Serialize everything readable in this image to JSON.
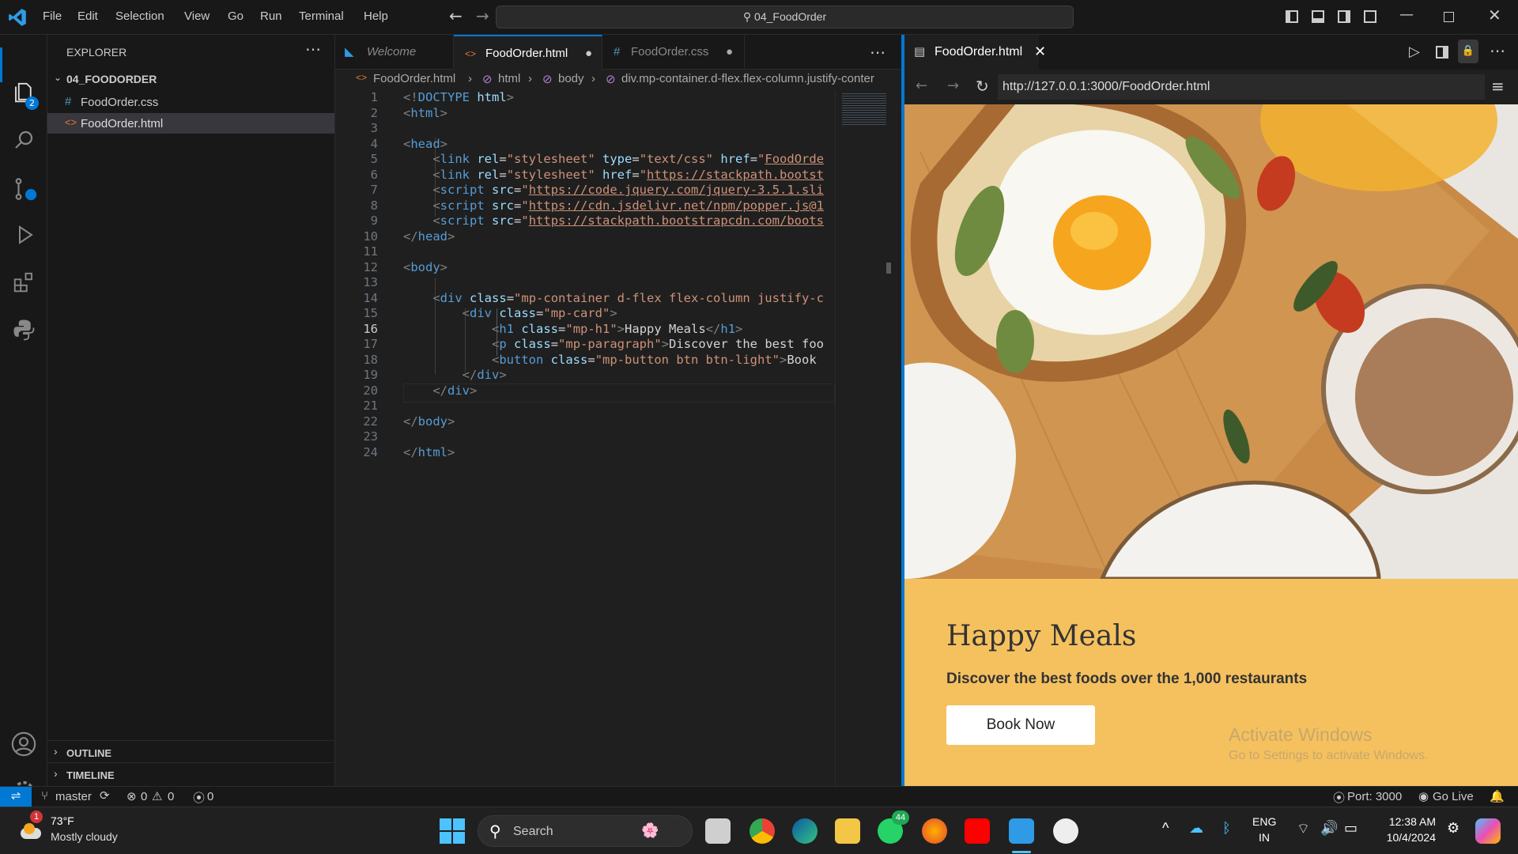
{
  "menu": {
    "file": "File",
    "edit": "Edit",
    "selection": "Selection",
    "view": "View",
    "go": "Go",
    "run": "Run",
    "terminal": "Terminal",
    "help": "Help"
  },
  "command_center": "04_FoodOrder",
  "activity_badge": "2",
  "explorer": {
    "title": "EXPLORER",
    "folder": "04_FOODORDER",
    "files": [
      "FoodOrder.css",
      "FoodOrder.html"
    ],
    "outline": "OUTLINE",
    "timeline": "TIMELINE"
  },
  "tabs": [
    "Welcome",
    "FoodOrder.html",
    "FoodOrder.css"
  ],
  "breadcrumb": {
    "file": "FoodOrder.html",
    "html": "html",
    "body": "body",
    "div": "div.mp-container.d-flex.flex-column.justify-conter"
  },
  "code_lines": [
    {
      "n": "1",
      "parts": [
        [
          "tg",
          "<!"
        ],
        [
          "kw",
          "DOCTYPE"
        ],
        [
          "tx",
          " "
        ],
        [
          "at",
          "html"
        ],
        [
          "tg",
          ">"
        ]
      ]
    },
    {
      "n": "2",
      "parts": [
        [
          "tg",
          "<"
        ],
        [
          "kw",
          "html"
        ],
        [
          "tg",
          ">"
        ]
      ]
    },
    {
      "n": "3",
      "parts": []
    },
    {
      "n": "4",
      "parts": [
        [
          "tg",
          "<"
        ],
        [
          "kw",
          "head"
        ],
        [
          "tg",
          ">"
        ]
      ]
    },
    {
      "n": "5",
      "parts": [
        [
          "tx",
          "    "
        ],
        [
          "tg",
          "<"
        ],
        [
          "kw",
          "link"
        ],
        [
          "tx",
          " "
        ],
        [
          "at",
          "rel"
        ],
        [
          "tx",
          "="
        ],
        [
          "st",
          "\"stylesheet\""
        ],
        [
          "tx",
          " "
        ],
        [
          "at",
          "type"
        ],
        [
          "tx",
          "="
        ],
        [
          "st",
          "\"text/css\""
        ],
        [
          "tx",
          " "
        ],
        [
          "at",
          "href"
        ],
        [
          "tx",
          "="
        ],
        [
          "st",
          "\""
        ],
        [
          "stu",
          "FoodOrde"
        ]
      ]
    },
    {
      "n": "6",
      "parts": [
        [
          "tx",
          "    "
        ],
        [
          "tg",
          "<"
        ],
        [
          "kw",
          "link"
        ],
        [
          "tx",
          " "
        ],
        [
          "at",
          "rel"
        ],
        [
          "tx",
          "="
        ],
        [
          "st",
          "\"stylesheet\""
        ],
        [
          "tx",
          " "
        ],
        [
          "at",
          "href"
        ],
        [
          "tx",
          "="
        ],
        [
          "st",
          "\""
        ],
        [
          "stu",
          "https://stackpath.bootst"
        ]
      ]
    },
    {
      "n": "7",
      "parts": [
        [
          "tx",
          "    "
        ],
        [
          "tg",
          "<"
        ],
        [
          "kw",
          "script"
        ],
        [
          "tx",
          " "
        ],
        [
          "at",
          "src"
        ],
        [
          "tx",
          "="
        ],
        [
          "st",
          "\""
        ],
        [
          "stu",
          "https://code.jquery.com/jquery-3.5.1.sli"
        ]
      ]
    },
    {
      "n": "8",
      "parts": [
        [
          "tx",
          "    "
        ],
        [
          "tg",
          "<"
        ],
        [
          "kw",
          "script"
        ],
        [
          "tx",
          " "
        ],
        [
          "at",
          "src"
        ],
        [
          "tx",
          "="
        ],
        [
          "st",
          "\""
        ],
        [
          "stu",
          "https://cdn.jsdelivr.net/npm/popper.js@1"
        ]
      ]
    },
    {
      "n": "9",
      "parts": [
        [
          "tx",
          "    "
        ],
        [
          "tg",
          "<"
        ],
        [
          "kw",
          "script"
        ],
        [
          "tx",
          " "
        ],
        [
          "at",
          "src"
        ],
        [
          "tx",
          "="
        ],
        [
          "st",
          "\""
        ],
        [
          "stu",
          "https://stackpath.bootstrapcdn.com/boots"
        ]
      ]
    },
    {
      "n": "10",
      "parts": [
        [
          "tg",
          "</"
        ],
        [
          "kw",
          "head"
        ],
        [
          "tg",
          ">"
        ]
      ]
    },
    {
      "n": "11",
      "parts": []
    },
    {
      "n": "12",
      "parts": [
        [
          "tg",
          "<"
        ],
        [
          "kw",
          "body"
        ],
        [
          "tg",
          ">"
        ]
      ]
    },
    {
      "n": "13",
      "parts": []
    },
    {
      "n": "14",
      "parts": [
        [
          "tx",
          "    "
        ],
        [
          "tg",
          "<"
        ],
        [
          "kw",
          "div"
        ],
        [
          "tx",
          " "
        ],
        [
          "at",
          "class"
        ],
        [
          "tx",
          "="
        ],
        [
          "st",
          "\"mp-container d-flex flex-column justify-c"
        ]
      ]
    },
    {
      "n": "15",
      "parts": [
        [
          "tx",
          "        "
        ],
        [
          "tg",
          "<"
        ],
        [
          "kw",
          "div"
        ],
        [
          "tx",
          " "
        ],
        [
          "at",
          "class"
        ],
        [
          "tx",
          "="
        ],
        [
          "st",
          "\"mp-card\""
        ],
        [
          "tg",
          ">"
        ]
      ]
    },
    {
      "n": "16",
      "parts": [
        [
          "tx",
          "            "
        ],
        [
          "tg",
          "<"
        ],
        [
          "kw",
          "h1"
        ],
        [
          "tx",
          " "
        ],
        [
          "at",
          "class"
        ],
        [
          "tx",
          "="
        ],
        [
          "st",
          "\"mp-h1\""
        ],
        [
          "tg",
          ">"
        ],
        [
          "tx",
          "Happy Meals"
        ],
        [
          "tg",
          "</"
        ],
        [
          "kw",
          "h1"
        ],
        [
          "tg",
          ">"
        ]
      ]
    },
    {
      "n": "17",
      "parts": [
        [
          "tx",
          "            "
        ],
        [
          "tg",
          "<"
        ],
        [
          "kw",
          "p"
        ],
        [
          "tx",
          " "
        ],
        [
          "at",
          "class"
        ],
        [
          "tx",
          "="
        ],
        [
          "st",
          "\"mp-paragraph\""
        ],
        [
          "tg",
          ">"
        ],
        [
          "tx",
          "Discover the best foo"
        ]
      ]
    },
    {
      "n": "18",
      "parts": [
        [
          "tx",
          "            "
        ],
        [
          "tg",
          "<"
        ],
        [
          "kw",
          "button"
        ],
        [
          "tx",
          " "
        ],
        [
          "at",
          "class"
        ],
        [
          "tx",
          "="
        ],
        [
          "st",
          "\"mp-button btn btn-light\""
        ],
        [
          "tg",
          ">"
        ],
        [
          "tx",
          "Book"
        ]
      ]
    },
    {
      "n": "19",
      "parts": [
        [
          "tx",
          "        "
        ],
        [
          "tg",
          "</"
        ],
        [
          "kw",
          "div"
        ],
        [
          "tg",
          ">"
        ]
      ]
    },
    {
      "n": "20",
      "parts": [
        [
          "tx",
          "    "
        ],
        [
          "tg",
          "</"
        ],
        [
          "kw",
          "div"
        ],
        [
          "tg",
          ">"
        ]
      ]
    },
    {
      "n": "21",
      "parts": []
    },
    {
      "n": "22",
      "parts": [
        [
          "tg",
          "</"
        ],
        [
          "kw",
          "body"
        ],
        [
          "tg",
          ">"
        ]
      ]
    },
    {
      "n": "23",
      "parts": []
    },
    {
      "n": "24",
      "parts": [
        [
          "tg",
          "</"
        ],
        [
          "kw",
          "html"
        ],
        [
          "tg",
          ">"
        ]
      ]
    }
  ],
  "browser": {
    "tab_title": "FoodOrder.html",
    "url": "http://127.0.0.1:3000/FoodOrder.html"
  },
  "page": {
    "heading": "Happy Meals",
    "paragraph": "Discover the best foods over the 1,000 restaurants",
    "button": "Book Now"
  },
  "watermark": {
    "title": "Activate Windows",
    "subtitle": "Go to Settings to activate Windows."
  },
  "status": {
    "branch": "master",
    "errors": "0",
    "warnings": "0",
    "ports": "0",
    "port": "Port: 3000",
    "golive": "Go Live"
  },
  "taskbar": {
    "weather_temp": "73°F",
    "weather_desc": "Mostly cloudy",
    "weather_badge": "1",
    "search": "Search",
    "whatsapp_badge": "44",
    "lang1": "ENG",
    "lang2": "IN",
    "time": "12:38 AM",
    "date": "10/4/2024"
  },
  "colors": {
    "accent": "#0078d4",
    "card": "#f5c15f"
  }
}
